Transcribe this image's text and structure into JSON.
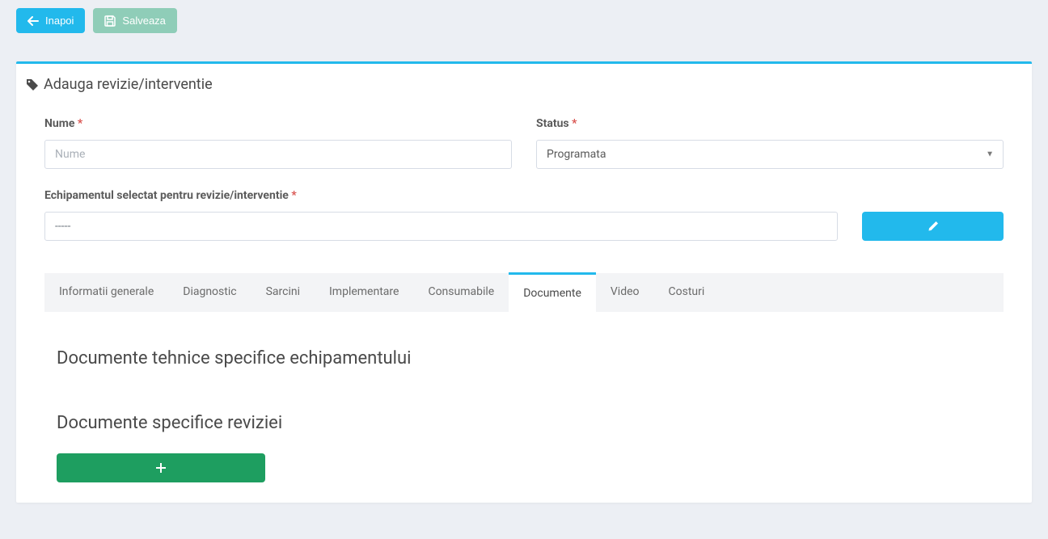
{
  "toolbar": {
    "back_label": "Inapoi",
    "save_label": "Salveaza"
  },
  "panel": {
    "title": "Adauga revizie/interventie"
  },
  "form": {
    "name_label": "Nume",
    "name_placeholder": "Nume",
    "status_label": "Status",
    "status_value": "Programata",
    "equipment_label": "Echipamentul selectat pentru revizie/interventie",
    "equipment_value": "-----"
  },
  "tabs": [
    {
      "label": "Informatii generale",
      "active": false
    },
    {
      "label": "Diagnostic",
      "active": false
    },
    {
      "label": "Sarcini",
      "active": false
    },
    {
      "label": "Implementare",
      "active": false
    },
    {
      "label": "Consumabile",
      "active": false
    },
    {
      "label": "Documente",
      "active": true
    },
    {
      "label": "Video",
      "active": false
    },
    {
      "label": "Costuri",
      "active": false
    }
  ],
  "content": {
    "section1_heading": "Documente tehnice specifice echipamentului",
    "section2_heading": "Documente specifice reviziei"
  }
}
